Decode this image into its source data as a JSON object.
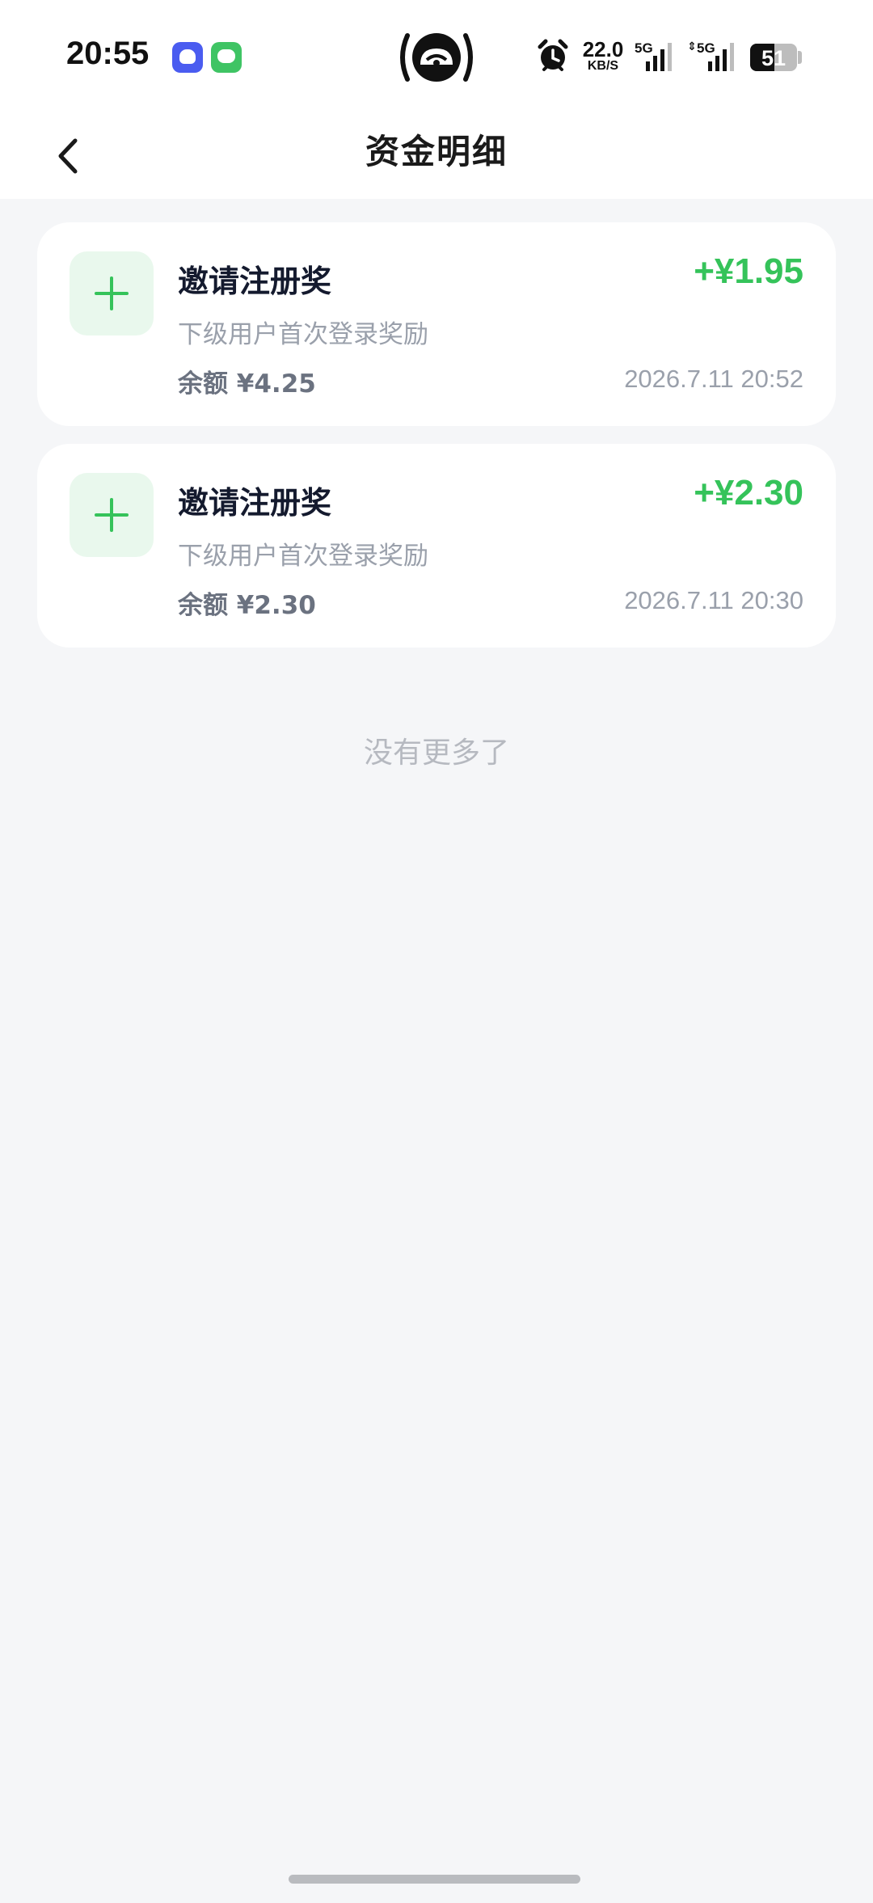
{
  "status_bar": {
    "time": "20:55",
    "net_speed_value": "22.0",
    "net_speed_unit": "KB/S",
    "signal_label": "5G",
    "battery_percent": "51",
    "battery_level": 0.51,
    "icons": [
      "app-chat-icon",
      "app-message-icon",
      "hotspot-icon",
      "alarm-icon",
      "signal-5g-icon",
      "signal-5g-data-icon",
      "battery-icon"
    ]
  },
  "header": {
    "title": "资金明细",
    "back_icon": "chevron-left-icon"
  },
  "records": [
    {
      "title": "邀请注册奖",
      "amount": "+¥1.95",
      "description": "下级用户首次登录奖励",
      "balance": "余额 ¥4.25",
      "time": "2026.7.11 20:52",
      "icon": "plus-icon"
    },
    {
      "title": "邀请注册奖",
      "amount": "+¥2.30",
      "description": "下级用户首次登录奖励",
      "balance": "余额 ¥2.30",
      "time": "2026.7.11 20:30",
      "icon": "plus-icon"
    }
  ],
  "footer": {
    "no_more": "没有更多了"
  },
  "colors": {
    "accent_green": "#35c35a",
    "icon_bg": "#e9f8ed",
    "page_bg": "#f5f6f8"
  }
}
